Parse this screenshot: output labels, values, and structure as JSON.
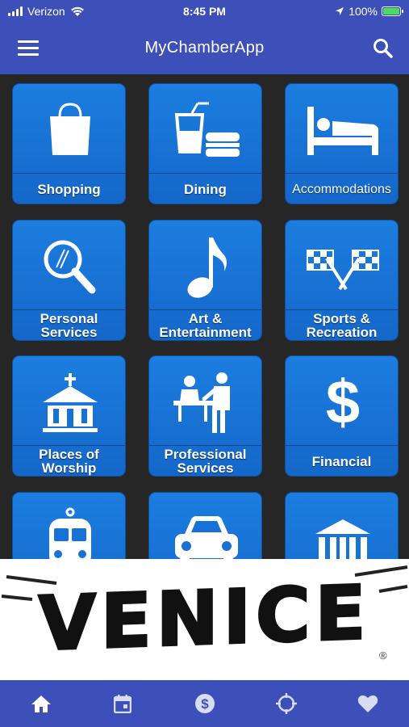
{
  "status_bar": {
    "carrier": "Verizon",
    "time": "8:45 PM",
    "battery": "100%"
  },
  "header": {
    "title": "MyChamberApp",
    "menu_icon": "menu-icon",
    "search_icon": "search-icon"
  },
  "tiles": [
    {
      "label": "Shopping",
      "icon": "shopping-bag-icon"
    },
    {
      "label": "Dining",
      "icon": "dining-icon"
    },
    {
      "label": "Accommodations",
      "icon": "bed-icon"
    },
    {
      "label": "Personal Services",
      "icon": "magnifier-icon"
    },
    {
      "label": "Art & Entertainment",
      "icon": "music-note-icon"
    },
    {
      "label": "Sports & Recreation",
      "icon": "racing-flags-icon"
    },
    {
      "label": "Places of Worship",
      "icon": "church-icon"
    },
    {
      "label": "Professional Services",
      "icon": "reception-desk-icon"
    },
    {
      "label": "Financial",
      "icon": "dollar-icon"
    },
    {
      "label": "",
      "icon": "train-icon"
    },
    {
      "label": "",
      "icon": "car-icon"
    },
    {
      "label": "",
      "icon": "government-building-icon"
    }
  ],
  "banner": {
    "text": "VENICE",
    "registered": "®"
  },
  "tab_bar": [
    {
      "icon": "home-icon"
    },
    {
      "icon": "calendar-icon"
    },
    {
      "icon": "dollar-circle-icon"
    },
    {
      "icon": "crosshair-icon"
    },
    {
      "icon": "heart-icon"
    }
  ],
  "colors": {
    "brand": "#3d4fb8",
    "tile": "#1c7ee0",
    "background": "#262626"
  }
}
